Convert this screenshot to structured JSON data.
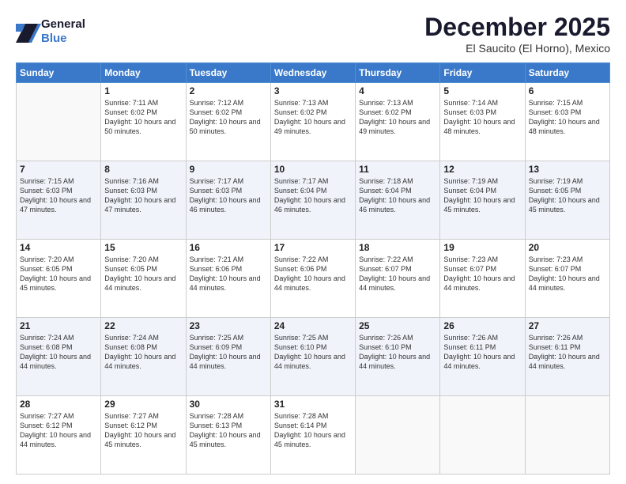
{
  "header": {
    "logo_line1": "General",
    "logo_line2": "Blue",
    "month": "December 2025",
    "location": "El Saucito (El Horno), Mexico"
  },
  "days_of_week": [
    "Sunday",
    "Monday",
    "Tuesday",
    "Wednesday",
    "Thursday",
    "Friday",
    "Saturday"
  ],
  "weeks": [
    [
      {
        "day": "",
        "sunrise": "",
        "sunset": "",
        "daylight": ""
      },
      {
        "day": "1",
        "sunrise": "7:11 AM",
        "sunset": "6:02 PM",
        "daylight": "10 hours and 50 minutes."
      },
      {
        "day": "2",
        "sunrise": "7:12 AM",
        "sunset": "6:02 PM",
        "daylight": "10 hours and 50 minutes."
      },
      {
        "day": "3",
        "sunrise": "7:13 AM",
        "sunset": "6:02 PM",
        "daylight": "10 hours and 49 minutes."
      },
      {
        "day": "4",
        "sunrise": "7:13 AM",
        "sunset": "6:02 PM",
        "daylight": "10 hours and 49 minutes."
      },
      {
        "day": "5",
        "sunrise": "7:14 AM",
        "sunset": "6:03 PM",
        "daylight": "10 hours and 48 minutes."
      },
      {
        "day": "6",
        "sunrise": "7:15 AM",
        "sunset": "6:03 PM",
        "daylight": "10 hours and 48 minutes."
      }
    ],
    [
      {
        "day": "7",
        "sunrise": "7:15 AM",
        "sunset": "6:03 PM",
        "daylight": "10 hours and 47 minutes."
      },
      {
        "day": "8",
        "sunrise": "7:16 AM",
        "sunset": "6:03 PM",
        "daylight": "10 hours and 47 minutes."
      },
      {
        "day": "9",
        "sunrise": "7:17 AM",
        "sunset": "6:03 PM",
        "daylight": "10 hours and 46 minutes."
      },
      {
        "day": "10",
        "sunrise": "7:17 AM",
        "sunset": "6:04 PM",
        "daylight": "10 hours and 46 minutes."
      },
      {
        "day": "11",
        "sunrise": "7:18 AM",
        "sunset": "6:04 PM",
        "daylight": "10 hours and 46 minutes."
      },
      {
        "day": "12",
        "sunrise": "7:19 AM",
        "sunset": "6:04 PM",
        "daylight": "10 hours and 45 minutes."
      },
      {
        "day": "13",
        "sunrise": "7:19 AM",
        "sunset": "6:05 PM",
        "daylight": "10 hours and 45 minutes."
      }
    ],
    [
      {
        "day": "14",
        "sunrise": "7:20 AM",
        "sunset": "6:05 PM",
        "daylight": "10 hours and 45 minutes."
      },
      {
        "day": "15",
        "sunrise": "7:20 AM",
        "sunset": "6:05 PM",
        "daylight": "10 hours and 44 minutes."
      },
      {
        "day": "16",
        "sunrise": "7:21 AM",
        "sunset": "6:06 PM",
        "daylight": "10 hours and 44 minutes."
      },
      {
        "day": "17",
        "sunrise": "7:22 AM",
        "sunset": "6:06 PM",
        "daylight": "10 hours and 44 minutes."
      },
      {
        "day": "18",
        "sunrise": "7:22 AM",
        "sunset": "6:07 PM",
        "daylight": "10 hours and 44 minutes."
      },
      {
        "day": "19",
        "sunrise": "7:23 AM",
        "sunset": "6:07 PM",
        "daylight": "10 hours and 44 minutes."
      },
      {
        "day": "20",
        "sunrise": "7:23 AM",
        "sunset": "6:07 PM",
        "daylight": "10 hours and 44 minutes."
      }
    ],
    [
      {
        "day": "21",
        "sunrise": "7:24 AM",
        "sunset": "6:08 PM",
        "daylight": "10 hours and 44 minutes."
      },
      {
        "day": "22",
        "sunrise": "7:24 AM",
        "sunset": "6:08 PM",
        "daylight": "10 hours and 44 minutes."
      },
      {
        "day": "23",
        "sunrise": "7:25 AM",
        "sunset": "6:09 PM",
        "daylight": "10 hours and 44 minutes."
      },
      {
        "day": "24",
        "sunrise": "7:25 AM",
        "sunset": "6:10 PM",
        "daylight": "10 hours and 44 minutes."
      },
      {
        "day": "25",
        "sunrise": "7:26 AM",
        "sunset": "6:10 PM",
        "daylight": "10 hours and 44 minutes."
      },
      {
        "day": "26",
        "sunrise": "7:26 AM",
        "sunset": "6:11 PM",
        "daylight": "10 hours and 44 minutes."
      },
      {
        "day": "27",
        "sunrise": "7:26 AM",
        "sunset": "6:11 PM",
        "daylight": "10 hours and 44 minutes."
      }
    ],
    [
      {
        "day": "28",
        "sunrise": "7:27 AM",
        "sunset": "6:12 PM",
        "daylight": "10 hours and 44 minutes."
      },
      {
        "day": "29",
        "sunrise": "7:27 AM",
        "sunset": "6:12 PM",
        "daylight": "10 hours and 45 minutes."
      },
      {
        "day": "30",
        "sunrise": "7:28 AM",
        "sunset": "6:13 PM",
        "daylight": "10 hours and 45 minutes."
      },
      {
        "day": "31",
        "sunrise": "7:28 AM",
        "sunset": "6:14 PM",
        "daylight": "10 hours and 45 minutes."
      },
      {
        "day": "",
        "sunrise": "",
        "sunset": "",
        "daylight": ""
      },
      {
        "day": "",
        "sunrise": "",
        "sunset": "",
        "daylight": ""
      },
      {
        "day": "",
        "sunrise": "",
        "sunset": "",
        "daylight": ""
      }
    ]
  ]
}
